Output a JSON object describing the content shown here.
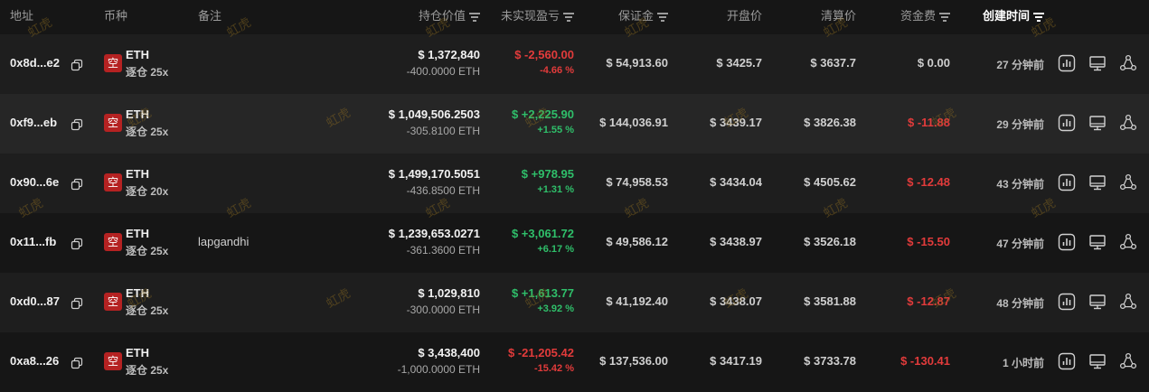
{
  "header": {
    "address": "地址",
    "coin": "币种",
    "note": "备注",
    "position_value": "持仓价值",
    "unrealized_pnl": "未实现盈亏",
    "margin": "保证金",
    "open_price": "开盘价",
    "liq_price": "清算价",
    "funding": "资金费",
    "created_time": "创建时间"
  },
  "watermark": "虹虎",
  "colors": {
    "red": "#e23b3b",
    "green": "#2fbf6a",
    "badge": "#b52222",
    "background": "#161616"
  },
  "rows": [
    {
      "address": "0x8d...e2",
      "side_badge": "空",
      "coin": "ETH",
      "leverage": "逐仓 25x",
      "note": "",
      "value": "$ 1,372,840",
      "qty": "-400.0000 ETH",
      "pnl": "$ -2,560.00",
      "pnl_pct": "-4.66 %",
      "pnl_sign": "red",
      "margin": "$ 54,913.60",
      "open": "$ 3425.7",
      "liq": "$ 3637.7",
      "funding": "$ 0.00",
      "funding_sign": "neutral",
      "time": "27 分钟前"
    },
    {
      "address": "0xf9...eb",
      "side_badge": "空",
      "coin": "ETH",
      "leverage": "逐仓 25x",
      "note": "",
      "value": "$ 1,049,506.2503",
      "qty": "-305.8100 ETH",
      "pnl": "$ +2,225.90",
      "pnl_pct": "+1.55 %",
      "pnl_sign": "green",
      "margin": "$ 144,036.91",
      "open": "$ 3439.17",
      "liq": "$ 3826.38",
      "funding": "$ -11.88",
      "funding_sign": "red",
      "time": "29 分钟前"
    },
    {
      "address": "0x90...6e",
      "side_badge": "空",
      "coin": "ETH",
      "leverage": "逐仓 20x",
      "note": "",
      "value": "$ 1,499,170.5051",
      "qty": "-436.8500 ETH",
      "pnl": "$ +978.95",
      "pnl_pct": "+1.31 %",
      "pnl_sign": "green",
      "margin": "$ 74,958.53",
      "open": "$ 3434.04",
      "liq": "$ 4505.62",
      "funding": "$ -12.48",
      "funding_sign": "red",
      "time": "43 分钟前"
    },
    {
      "address": "0x11...fb",
      "side_badge": "空",
      "coin": "ETH",
      "leverage": "逐仓 25x",
      "note": "lapgandhi",
      "value": "$ 1,239,653.0271",
      "qty": "-361.3600 ETH",
      "pnl": "$ +3,061.72",
      "pnl_pct": "+6.17 %",
      "pnl_sign": "green",
      "margin": "$ 49,586.12",
      "open": "$ 3438.97",
      "liq": "$ 3526.18",
      "funding": "$ -15.50",
      "funding_sign": "red",
      "time": "47 分钟前"
    },
    {
      "address": "0xd0...87",
      "side_badge": "空",
      "coin": "ETH",
      "leverage": "逐仓 25x",
      "note": "",
      "value": "$ 1,029,810",
      "qty": "-300.0000 ETH",
      "pnl": "$ +1,613.77",
      "pnl_pct": "+3.92 %",
      "pnl_sign": "green",
      "margin": "$ 41,192.40",
      "open": "$ 3438.07",
      "liq": "$ 3581.88",
      "funding": "$ -12.87",
      "funding_sign": "red",
      "time": "48 分钟前"
    },
    {
      "address": "0xa8...26",
      "side_badge": "空",
      "coin": "ETH",
      "leverage": "逐仓 25x",
      "note": "",
      "value": "$ 3,438,400",
      "qty": "-1,000.0000 ETH",
      "pnl": "$ -21,205.42",
      "pnl_pct": "-15.42 %",
      "pnl_sign": "red",
      "margin": "$ 137,536.00",
      "open": "$ 3417.19",
      "liq": "$ 3733.78",
      "funding": "$ -130.41",
      "funding_sign": "red",
      "time": "1 小时前"
    }
  ]
}
